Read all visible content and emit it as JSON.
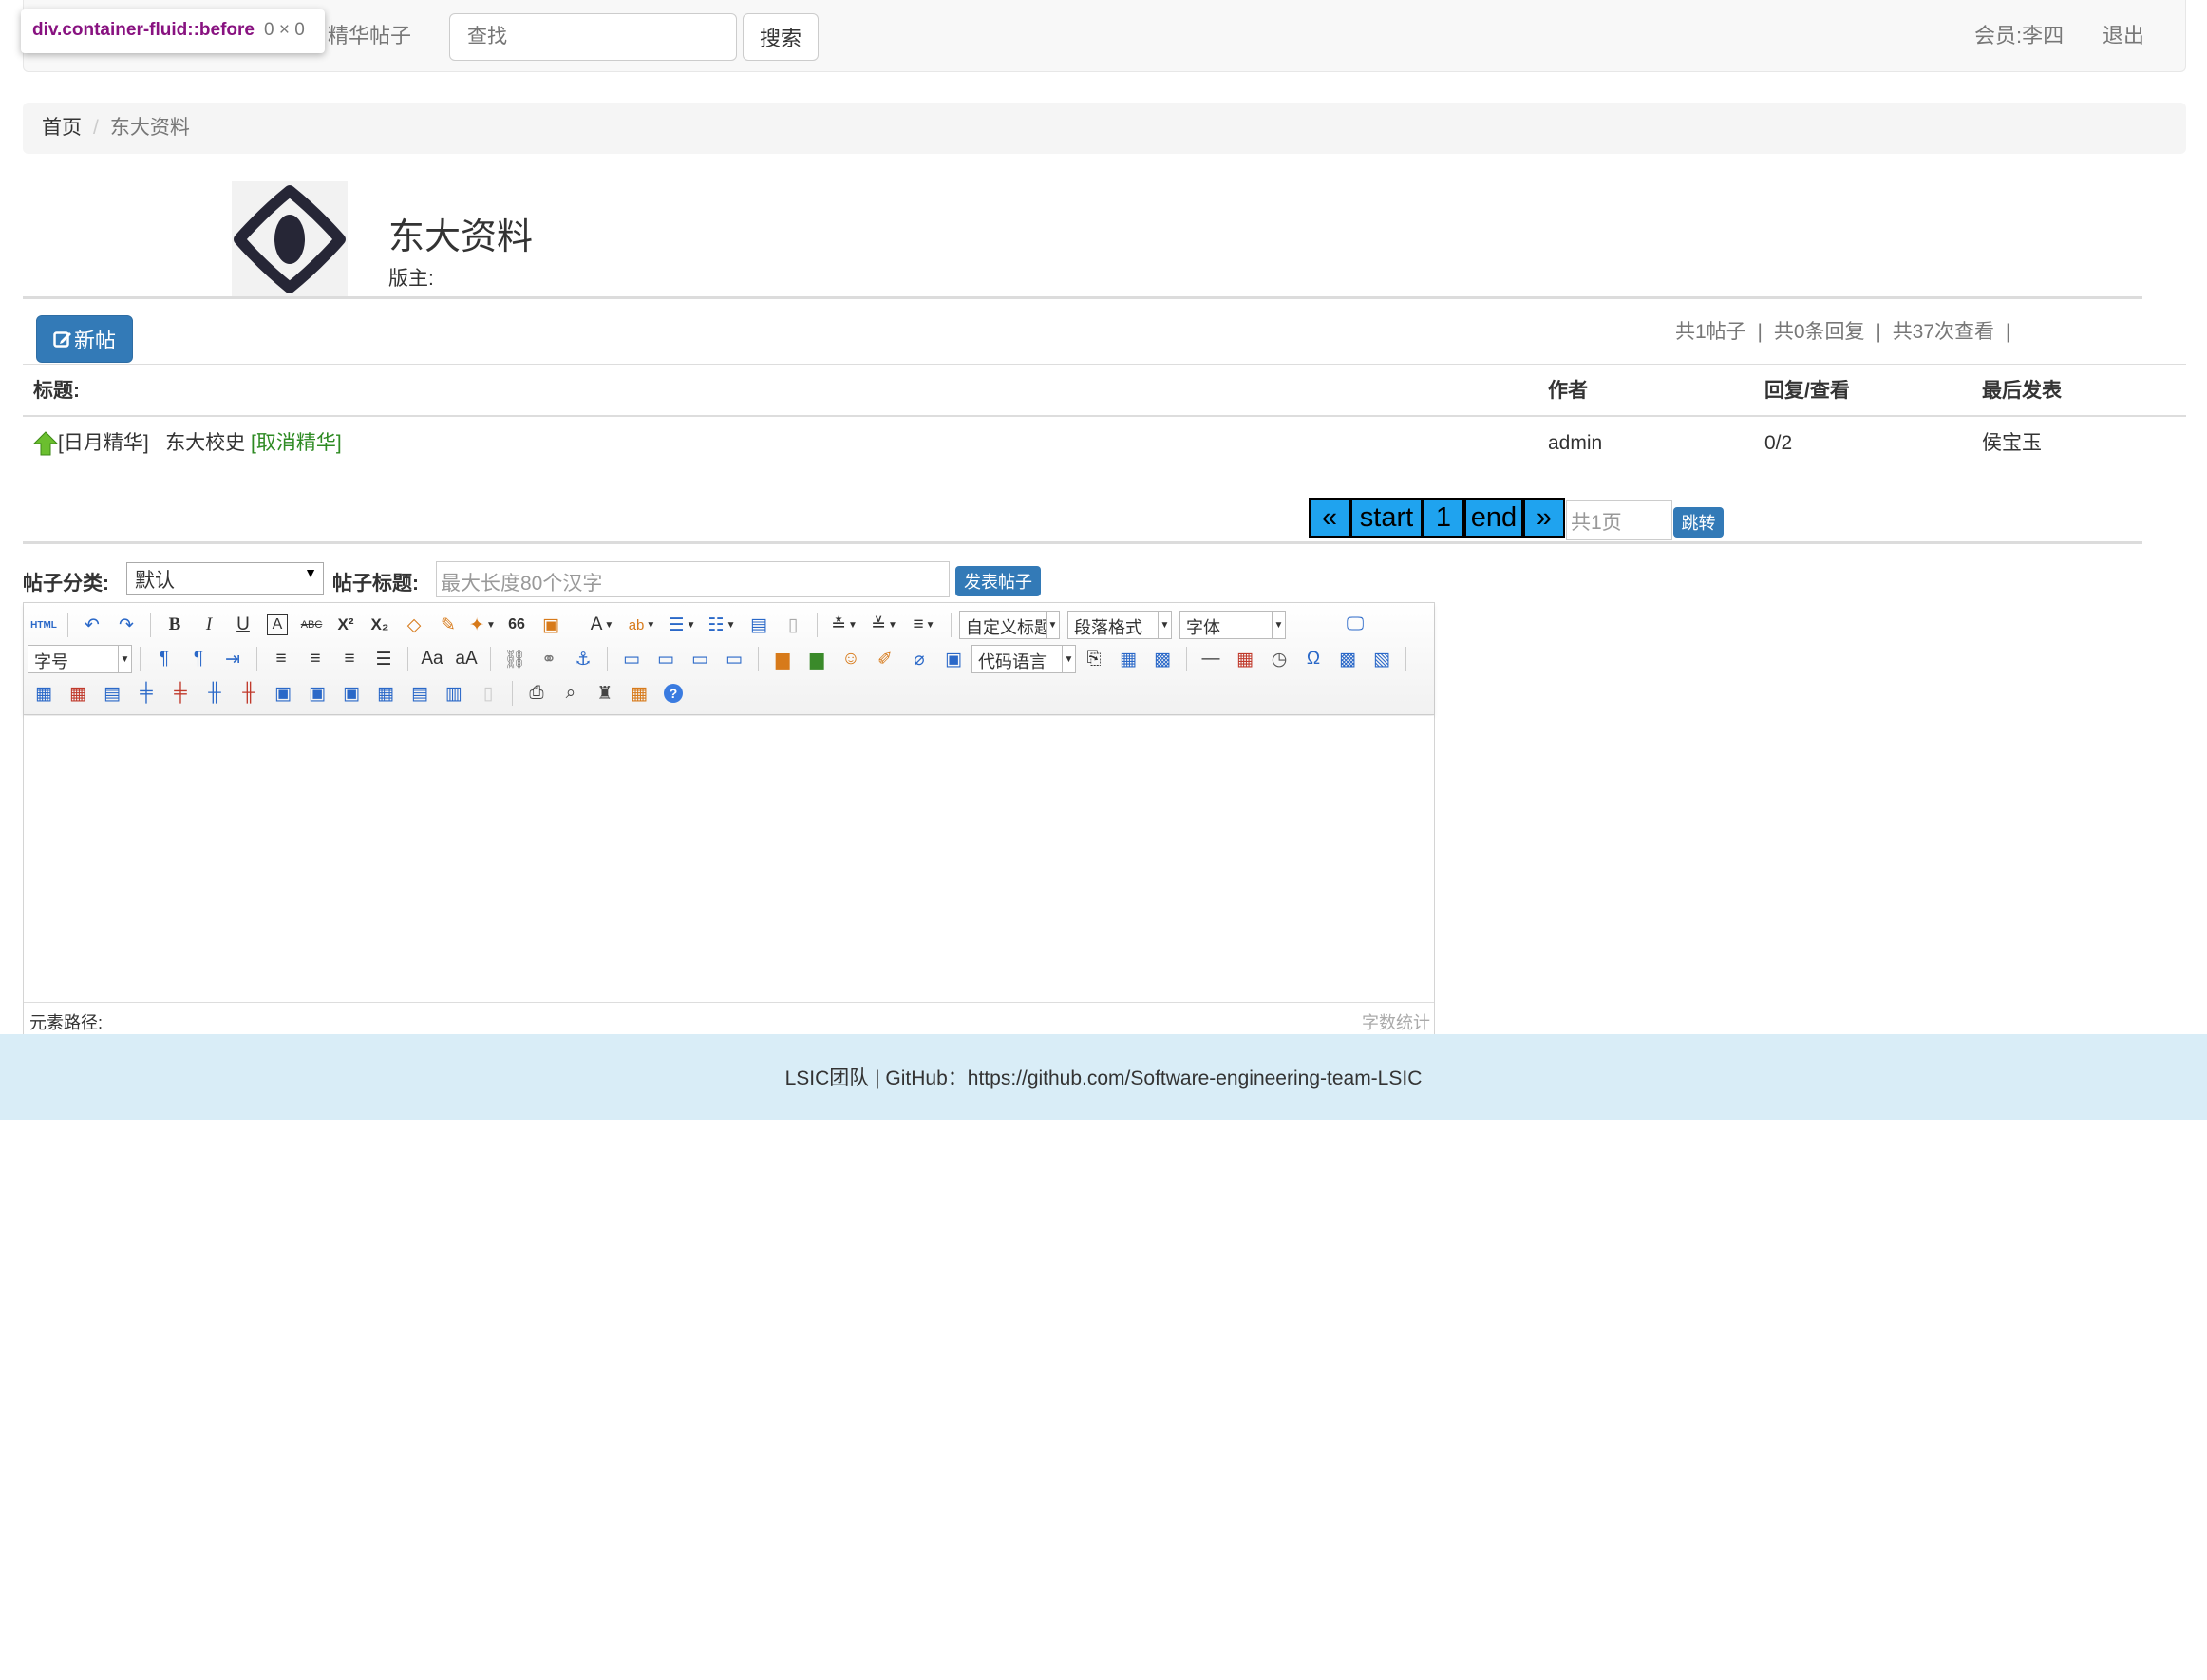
{
  "navbar": {
    "featured_link": "精华帖子",
    "search_placeholder": "查找",
    "search_button": "搜索",
    "member_label": "会员:李四",
    "logout": "退出"
  },
  "devtools_tooltip": {
    "selector": "div.container-fluid::before",
    "size": "0 × 0"
  },
  "breadcrumb": {
    "home": "首页",
    "separator": "/",
    "current": "东大资料"
  },
  "forum": {
    "title": "东大资料",
    "moderator_label": "版主:",
    "new_post_button": "新帖",
    "stats": {
      "posts": "共1帖子",
      "sep1": "|",
      "replies": "共0条回复",
      "sep2": "|",
      "views": "共37次查看",
      "sep3": "|"
    }
  },
  "table": {
    "headers": [
      "标题:",
      "作者",
      "回复/查看",
      "最后发表"
    ],
    "rows": [
      {
        "tag": "[日月精华]",
        "title": "东大校史",
        "action": "[取消精华]",
        "author": "admin",
        "reply_view": "0/2",
        "last_poster": "侯宝玉"
      }
    ]
  },
  "pagination": {
    "prev": "«",
    "start": "start",
    "page": "1",
    "end": "end",
    "next": "»",
    "total_placeholder": "共1页",
    "go": "跳转"
  },
  "post_form": {
    "category_label": "帖子分类:",
    "category_value": "默认",
    "title_label": "帖子标题:",
    "title_placeholder": "最大长度80个汉字",
    "submit": "发表帖子"
  },
  "editor": {
    "combos": {
      "custom_title": "自定义标题",
      "paragraph": "段落格式",
      "font": "字体",
      "font_size": "字号",
      "code_lang": "代码语言"
    },
    "icons": {
      "html": "HTML",
      "bold": "B",
      "italic": "I",
      "underline": "U",
      "font_border": "A",
      "strikethrough": "ABC",
      "superscript": "X²",
      "subscript": "X₂",
      "quote": "66",
      "font_color": "A",
      "background_color": "ab",
      "omega": "Ω",
      "help": "?"
    },
    "element_path": "元素路径:",
    "word_count": "字数统计"
  },
  "footer": {
    "text": "LSIC团队 | GitHub：https://github.com/Software-engineering-team-LSIC"
  }
}
